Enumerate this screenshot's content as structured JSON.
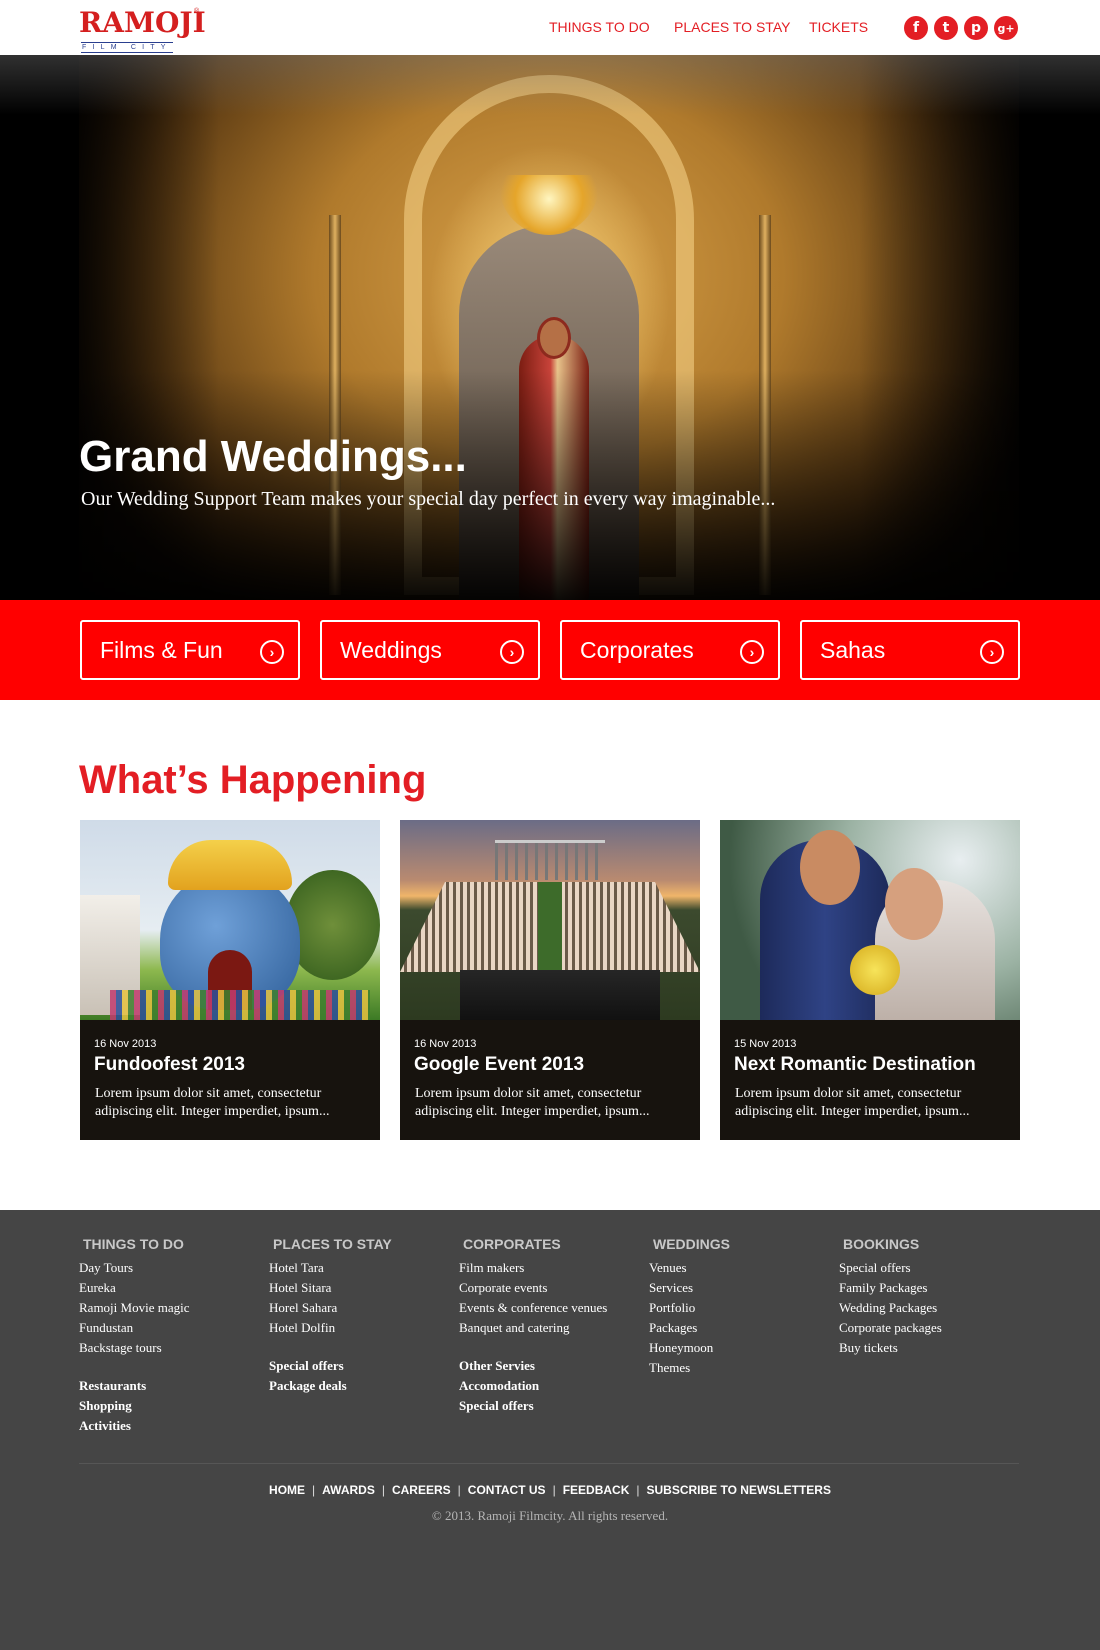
{
  "header": {
    "logo": {
      "word": "RAMOJI",
      "tagline": "FILM CITY",
      "reg": "®"
    },
    "nav": [
      {
        "label": "THINGS TO DO"
      },
      {
        "label": "PLACES TO STAY"
      },
      {
        "label": "TICKETS"
      }
    ],
    "social": [
      {
        "icon": "facebook-icon",
        "glyph": "f"
      },
      {
        "icon": "twitter-icon",
        "glyph": "t"
      },
      {
        "icon": "pinterest-icon",
        "glyph": "p"
      },
      {
        "icon": "google-plus-icon",
        "glyph": "g+"
      }
    ]
  },
  "hero": {
    "title": "Grand Weddings...",
    "subtitle": "Our Wedding Support Team makes your special day perfect in every way imaginable..."
  },
  "categories": [
    {
      "label": "Films & Fun"
    },
    {
      "label": "Weddings"
    },
    {
      "label": "Corporates"
    },
    {
      "label": "Sahas"
    }
  ],
  "happening": {
    "title": "What’s Happening",
    "cards": [
      {
        "date": "16 Nov 2013",
        "title": "Fundoofest 2013",
        "desc": "Lorem ipsum dolor sit amet, consectetur adipiscing elit. Integer imperdiet, ipsum..."
      },
      {
        "date": "16 Nov 2013",
        "title": "Google Event 2013",
        "desc": "Lorem ipsum dolor sit amet, consectetur adipiscing elit. Integer imperdiet, ipsum..."
      },
      {
        "date": "15 Nov 2013",
        "title": "Next Romantic Destination",
        "desc": "Lorem ipsum dolor sit amet, consectetur adipiscing elit. Integer imperdiet, ipsum..."
      }
    ]
  },
  "footer": {
    "columns": [
      {
        "heading": "THINGS TO DO",
        "links": [
          "Day Tours",
          "Eureka",
          "Ramoji Movie magic",
          "Fundustan",
          "Backstage tours"
        ],
        "bold": [
          "Restaurants",
          "Shopping",
          "Activities"
        ]
      },
      {
        "heading": "PLACES TO STAY",
        "links": [
          "Hotel Tara",
          "Hotel Sitara",
          "Horel Sahara",
          "Hotel Dolfin"
        ],
        "bold": [
          "Special offers",
          "Package deals"
        ]
      },
      {
        "heading": "CORPORATES",
        "links": [
          "Film makers",
          "Corporate events",
          "Events & conference venues",
          "Banquet and catering"
        ],
        "bold": [
          "Other Servies",
          "Accomodation",
          "Special offers"
        ]
      },
      {
        "heading": "WEDDINGS",
        "links": [
          "Venues",
          "Services",
          "Portfolio",
          "Packages",
          "Honeymoon",
          "Themes"
        ],
        "bold": []
      },
      {
        "heading": "BOOKINGS",
        "links": [
          "Special offers",
          "Family Packages",
          "Wedding Packages",
          "Corporate packages",
          "Buy tickets"
        ],
        "bold": []
      }
    ],
    "bottom_nav": [
      "HOME",
      "AWARDS",
      "CAREERS",
      "CONTACT US",
      "FEEDBACK",
      "SUBSCRIBE TO NEWSLETTERS"
    ],
    "copyright": "© 2013. Ramoji Filmcity. All rights reserved."
  },
  "colors": {
    "brand_red": "#e31e24",
    "band_red": "#ff0000",
    "footer_bg": "#454545",
    "card_bg": "#17130e"
  }
}
